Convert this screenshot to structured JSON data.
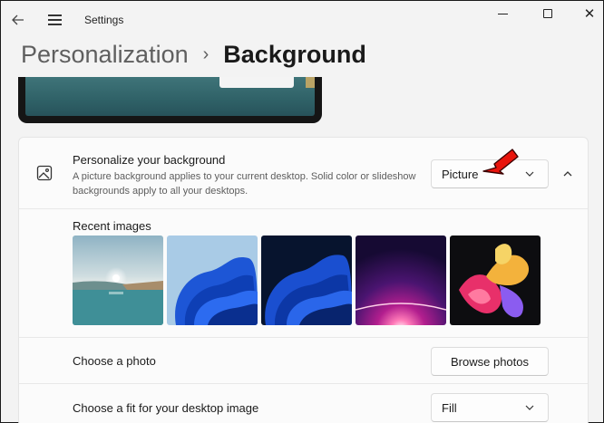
{
  "window": {
    "title": "Settings",
    "back_icon": "back-arrow-icon",
    "menu_icon": "hamburger-menu-icon",
    "close_glyph": "✕"
  },
  "breadcrumb": {
    "parent": "Personalization",
    "separator": "›",
    "current": "Background"
  },
  "background_setting": {
    "title": "Personalize your background",
    "description": "A picture background applies to your current desktop. Solid color or slideshow backgrounds apply to all your desktops.",
    "selected_value": "Picture",
    "icon": "picture-icon"
  },
  "recent_images": {
    "label": "Recent images",
    "thumbnails": [
      {
        "name": "lake-sunrise"
      },
      {
        "name": "blue-bloom-light"
      },
      {
        "name": "blue-bloom-dark"
      },
      {
        "name": "purple-glow"
      },
      {
        "name": "colorful-ribbons"
      }
    ]
  },
  "choose_photo": {
    "label": "Choose a photo",
    "button": "Browse photos"
  },
  "fit": {
    "label": "Choose a fit for your desktop image",
    "selected_value": "Fill"
  },
  "colors": {
    "accent_annotation": "#e8140c",
    "window_bg": "#f3f3f3",
    "card_bg": "#fbfbfb"
  }
}
